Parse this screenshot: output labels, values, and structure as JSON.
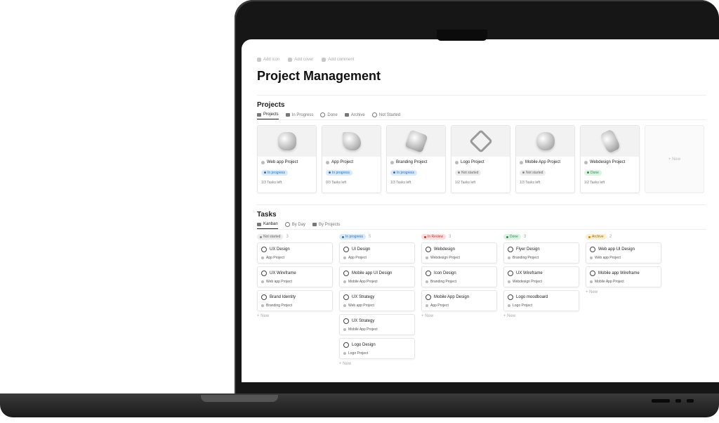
{
  "page": {
    "top_actions": [
      "Add icon",
      "Add cover",
      "Add comment"
    ],
    "title": "Project Management"
  },
  "projects": {
    "title": "Projects",
    "tabs": [
      "Projects",
      "In Progress",
      "Done",
      "Archive",
      "Not Started"
    ],
    "new_label": "+ New",
    "cards": [
      {
        "name": "Web app Project",
        "status": "In progress",
        "status_kind": "progress",
        "tasks": "1/3 Tasks left"
      },
      {
        "name": "App Project",
        "status": "In progress",
        "status_kind": "progress",
        "tasks": "0/3 Tasks left"
      },
      {
        "name": "Branding Project",
        "status": "In progress",
        "status_kind": "progress",
        "tasks": "1/3 Tasks left"
      },
      {
        "name": "Logo Project",
        "status": "Not started",
        "status_kind": "notstarted",
        "tasks": "1/2 Tasks left"
      },
      {
        "name": "Mobile App Project",
        "status": "Not started",
        "status_kind": "notstarted",
        "tasks": "1/3 Tasks left"
      },
      {
        "name": "Webdesign Project",
        "status": "Done",
        "status_kind": "done",
        "tasks": "1/2 Tasks left"
      }
    ]
  },
  "tasks": {
    "title": "Tasks",
    "tabs": [
      "Kanban",
      "By Day",
      "By Projects"
    ],
    "new_label": "+ New",
    "columns": [
      {
        "name": "Not started",
        "kind": "notstarted",
        "count": "3",
        "cards": [
          {
            "name": "UX Design",
            "project": "App Project"
          },
          {
            "name": "UX Wireframe",
            "project": "Web app Project"
          },
          {
            "name": "Brand Identity",
            "project": "Branding Project"
          }
        ]
      },
      {
        "name": "In progress",
        "kind": "progress",
        "count": "5",
        "cards": [
          {
            "name": "UI Design",
            "project": "App Project"
          },
          {
            "name": "Mobile app UI Design",
            "project": "Mobile App Project"
          },
          {
            "name": "UX Strategy",
            "project": "Web app Project"
          },
          {
            "name": "UX Strategy",
            "project": "Mobile App Project"
          },
          {
            "name": "Logo Design",
            "project": "Logo Project"
          }
        ]
      },
      {
        "name": "In Review",
        "kind": "review",
        "count": "3",
        "cards": [
          {
            "name": "Webdesign",
            "project": "Webdesign Project"
          },
          {
            "name": "Icon Design",
            "project": "Branding Project"
          },
          {
            "name": "Mobile App Design",
            "project": "App Project"
          }
        ]
      },
      {
        "name": "Done",
        "kind": "done",
        "count": "3",
        "cards": [
          {
            "name": "Flyer Design",
            "project": "Branding Project"
          },
          {
            "name": "UX Wireframe",
            "project": "Webdesign Project"
          },
          {
            "name": "Logo moodboard",
            "project": "Logo Project"
          }
        ]
      },
      {
        "name": "Archive",
        "kind": "archive",
        "count": "2",
        "cards": [
          {
            "name": "Web app UI Design",
            "project": "Web app Project"
          },
          {
            "name": "Mobile app Wireframe",
            "project": "Mobile App Project"
          }
        ]
      }
    ]
  }
}
